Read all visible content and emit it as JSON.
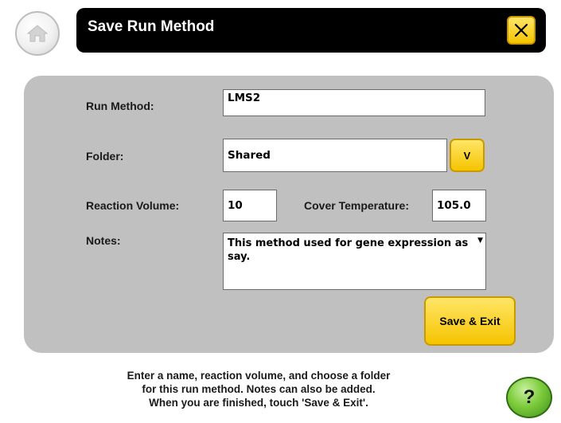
{
  "header": {
    "title": "Save Run Method",
    "home_icon": "home-icon",
    "close_icon": "close-icon"
  },
  "form": {
    "run_method": {
      "label": "Run Method:",
      "value": "LMS2"
    },
    "folder": {
      "label": "Folder:",
      "value": "Shared",
      "dropdown_label": "V"
    },
    "reaction_volume": {
      "label": "Reaction Volume:",
      "value": "10"
    },
    "cover_temperature": {
      "label": "Cover Temperature:",
      "value": "105.0"
    },
    "notes": {
      "label": "Notes:",
      "value": "This method used for gene expression assay."
    },
    "save_label": "Save & Exit"
  },
  "help": {
    "lines": [
      "Enter a name, reaction volume, and choose a folder",
      "for this run method. Notes can also be added.",
      "When you are finished, touch 'Save & Exit'."
    ],
    "button_label": "?"
  },
  "colors": {
    "accent_yellow": "#f5c400",
    "panel_gray": "#c0c0c0",
    "title_bar": "#000000",
    "help_green": "#7dcc3c"
  }
}
